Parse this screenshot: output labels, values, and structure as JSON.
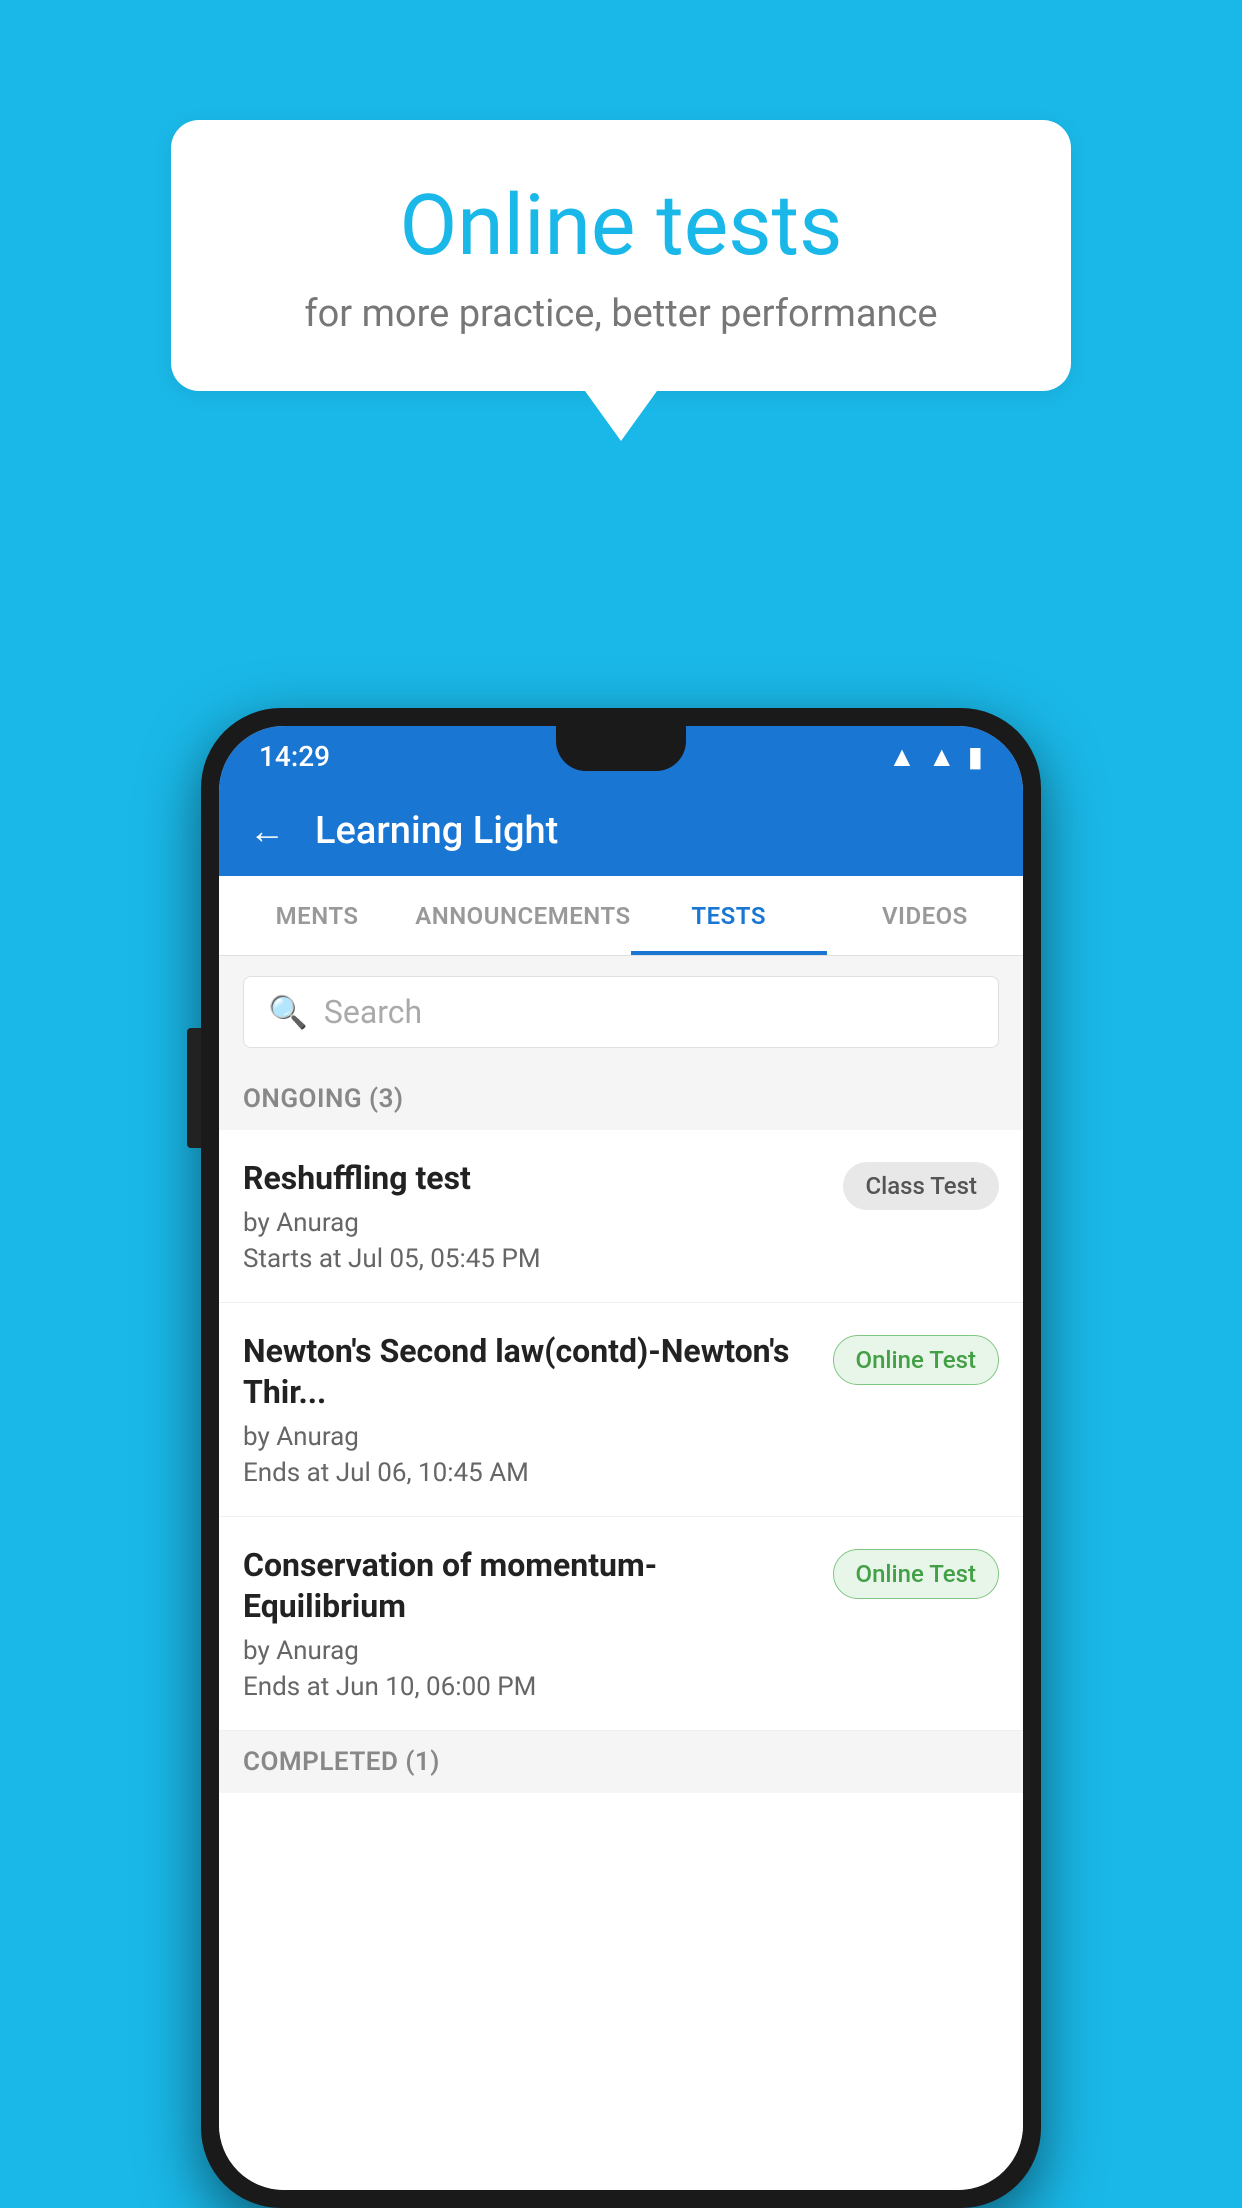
{
  "background_color": "#1ab8e8",
  "speech_bubble": {
    "title": "Online tests",
    "subtitle": "for more practice, better performance"
  },
  "phone": {
    "status_bar": {
      "time": "14:29",
      "icons": [
        "wifi",
        "signal",
        "battery"
      ]
    },
    "header": {
      "title": "Learning Light",
      "back_label": "←"
    },
    "tabs": [
      {
        "label": "MENTS",
        "active": false
      },
      {
        "label": "ANNOUNCEMENTS",
        "active": false
      },
      {
        "label": "TESTS",
        "active": true
      },
      {
        "label": "VIDEOS",
        "active": false
      }
    ],
    "search": {
      "placeholder": "Search"
    },
    "ongoing_section": {
      "label": "ONGOING (3)",
      "tests": [
        {
          "name": "Reshuffling test",
          "author": "by Anurag",
          "time_label": "Starts at",
          "time": "Jul 05, 05:45 PM",
          "badge": "Class Test",
          "badge_type": "class"
        },
        {
          "name": "Newton's Second law(contd)-Newton's Thir...",
          "author": "by Anurag",
          "time_label": "Ends at",
          "time": "Jul 06, 10:45 AM",
          "badge": "Online Test",
          "badge_type": "online"
        },
        {
          "name": "Conservation of momentum-Equilibrium",
          "author": "by Anurag",
          "time_label": "Ends at",
          "time": "Jun 10, 06:00 PM",
          "badge": "Online Test",
          "badge_type": "online"
        }
      ]
    },
    "completed_section": {
      "label": "COMPLETED (1)"
    }
  }
}
